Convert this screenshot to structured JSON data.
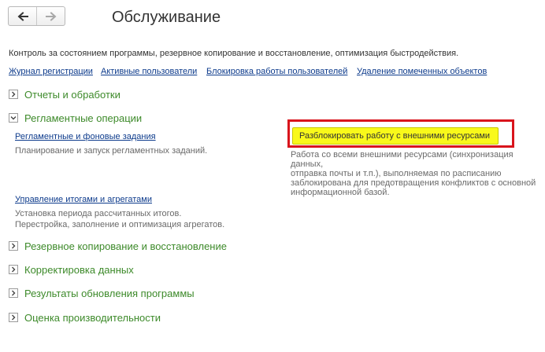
{
  "header": {
    "back_icon": "arrow-left-icon",
    "forward_icon": "arrow-right-icon",
    "title": "Обслуживание"
  },
  "description": "Контроль за состоянием программы, резервное копирование и восстановление, оптимизация быстродействия.",
  "top_links": [
    {
      "label": "Журнал регистрации"
    },
    {
      "label": "Активные пользователи"
    },
    {
      "label": "Блокировка работы пользователей"
    },
    {
      "label": "Удаление помеченных объектов"
    }
  ],
  "sections": [
    {
      "label": "Отчеты и обработки",
      "expanded": false
    },
    {
      "label": "Регламентные операции",
      "expanded": true,
      "items": [
        {
          "link": "Регламентные и фоновые задания",
          "description": "Планирование и запуск регламентных заданий."
        },
        {
          "link": "Управление итогами и агрегатами",
          "description_lines": [
            "Установка периода рассчитанных итогов.",
            "Перестройка, заполнение и оптимизация агрегатов."
          ]
        }
      ],
      "action": {
        "button": "Разблокировать работу с внешними ресурсами",
        "description_lines": [
          "Работа со всеми внешними ресурсами (синхронизация данных,",
          "отправка почты и т.п.), выполняемая по расписанию",
          "заблокирована для предотвращения конфликтов с основной",
          "информационной базой."
        ]
      }
    },
    {
      "label": "Резервное копирование и восстановление",
      "expanded": false
    },
    {
      "label": "Корректировка данных",
      "expanded": false
    },
    {
      "label": "Результаты обновления программы",
      "expanded": false
    },
    {
      "label": "Оценка производительности",
      "expanded": false
    }
  ],
  "colors": {
    "section_label": "#3d8a2a",
    "link": "#0d3b8c",
    "highlight_button": "#f9f91a",
    "highlight_frame": "#d9141c"
  }
}
